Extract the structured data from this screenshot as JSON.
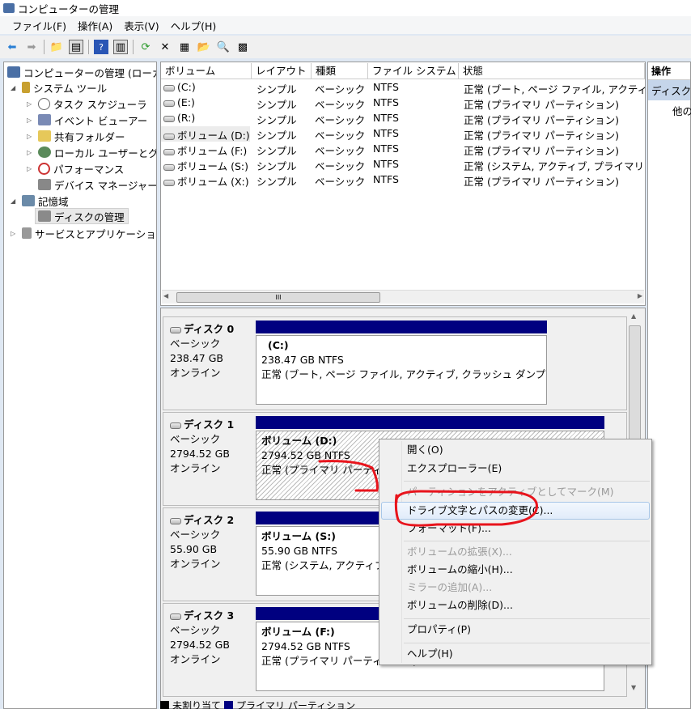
{
  "window": {
    "title": "コンピューターの管理"
  },
  "menu": [
    "ファイル(F)",
    "操作(A)",
    "表示(V)",
    "ヘルプ(H)"
  ],
  "toolbar": {
    "icons": [
      "back-icon",
      "forward-icon",
      "up-folder-icon",
      "show-tree-icon",
      "help-icon",
      "show-action-pane-icon",
      "refresh-icon",
      "delete-icon",
      "properties-icon",
      "open-folder-icon",
      "search-icon",
      "settings-icon"
    ]
  },
  "tree": {
    "root": "コンピューターの管理 (ローカル)",
    "system_tools": "システム ツール",
    "task_scheduler": "タスク スケジューラ",
    "event_viewer": "イベント ビューアー",
    "shared_folders": "共有フォルダー",
    "local_users": "ローカル ユーザーとグループ",
    "performance": "パフォーマンス",
    "device_manager": "デバイス マネージャー",
    "storage": "記憶域",
    "disk_management": "ディスクの管理",
    "services": "サービスとアプリケーション"
  },
  "volume_list": {
    "headers": [
      "ボリューム",
      "レイアウト",
      "種類",
      "ファイル システム",
      "状態"
    ],
    "rows": [
      [
        "(C:)",
        "シンプル",
        "ベーシック",
        "NTFS",
        "正常 (ブート, ページ ファイル, アクティブ"
      ],
      [
        "(E:)",
        "シンプル",
        "ベーシック",
        "NTFS",
        "正常 (プライマリ パーティション)"
      ],
      [
        "(R:)",
        "シンプル",
        "ベーシック",
        "NTFS",
        "正常 (プライマリ パーティション)"
      ],
      [
        "ボリューム (D:)",
        "シンプル",
        "ベーシック",
        "NTFS",
        "正常 (プライマリ パーティション)"
      ],
      [
        "ボリューム (F:)",
        "シンプル",
        "ベーシック",
        "NTFS",
        "正常 (プライマリ パーティション)"
      ],
      [
        "ボリューム (S:)",
        "シンプル",
        "ベーシック",
        "NTFS",
        "正常 (システム, アクティブ, プライマリ"
      ],
      [
        "ボリューム (X:)",
        "シンプル",
        "ベーシック",
        "NTFS",
        "正常 (プライマリ パーティション)"
      ]
    ],
    "scroll_grip": "III"
  },
  "disks": [
    {
      "name": "ディスク 0",
      "type": "ベーシック",
      "size": "238.47 GB",
      "status": "オンライン",
      "volume": "(C:)",
      "vol_size": "238.47 GB NTFS",
      "vol_status": "正常 (ブート, ページ ファイル, アクティブ, クラッシュ ダンプ,"
    },
    {
      "name": "ディスク 1",
      "type": "ベーシック",
      "size": "2794.52 GB",
      "status": "オンライン",
      "volume": "ボリューム (D:)",
      "vol_size": "2794.52 GB NTFS",
      "vol_status": "正常 (プライマリ パーティション)"
    },
    {
      "name": "ディスク 2",
      "type": "ベーシック",
      "size": "55.90 GB",
      "status": "オンライン",
      "volume": "ボリューム (S:)",
      "vol_size": "55.90 GB NTFS",
      "vol_status": "正常 (システム, アクティブ, プライマリ パーティション)"
    },
    {
      "name": "ディスク 3",
      "type": "ベーシック",
      "size": "2794.52 GB",
      "status": "オンライン",
      "volume": "ボリューム (F:)",
      "vol_size": "2794.52 GB NTFS",
      "vol_status": "正常 (プライマリ パーティション)"
    }
  ],
  "legend": {
    "unallocated": "未割り当て",
    "primary": "プライマリ パーティション"
  },
  "actions": {
    "title": "操作",
    "section": "ディスクの管理",
    "more": "他の操作"
  },
  "context_menu": {
    "open": "開く(O)",
    "explore": "エクスプローラー(E)",
    "mark_active": "パーティションをアクティブとしてマーク(M)",
    "change_letter": "ドライブ文字とパスの変更(C)...",
    "format": "フォーマット(F)...",
    "extend": "ボリュームの拡張(X)...",
    "shrink": "ボリュームの縮小(H)...",
    "mirror": "ミラーの追加(A)...",
    "delete": "ボリュームの削除(D)...",
    "properties": "プロパティ(P)",
    "help": "ヘルプ(H)"
  },
  "colors": {
    "partition_bar": "#000080",
    "annotation": "#e8141c",
    "highlight": "#e1ecfa"
  }
}
